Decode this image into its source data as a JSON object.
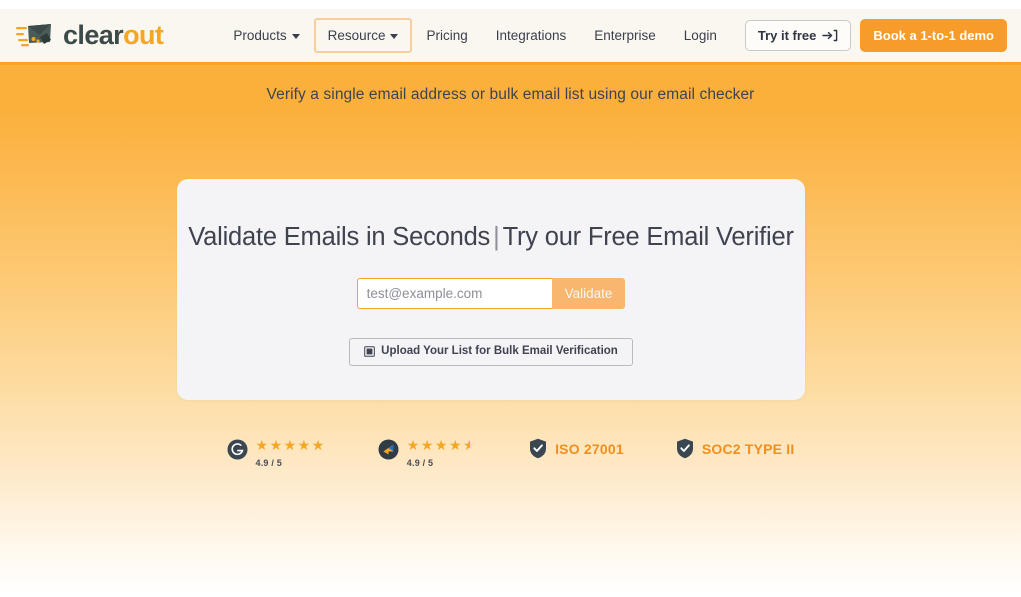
{
  "header": {
    "logo": {
      "icon": "envelope-megaphone-icon",
      "text_primary": "clear",
      "text_accent": "out",
      "accent_color": "#f6a623",
      "primary_color": "#3c4b4a"
    },
    "nav": [
      {
        "label": "Products",
        "has_dropdown": true,
        "focused": false
      },
      {
        "label": "Resource",
        "has_dropdown": true,
        "focused": true
      },
      {
        "label": "Pricing",
        "has_dropdown": false,
        "focused": false
      },
      {
        "label": "Integrations",
        "has_dropdown": false,
        "focused": false
      },
      {
        "label": "Enterprise",
        "has_dropdown": false,
        "focused": false
      },
      {
        "label": "Login",
        "has_dropdown": false,
        "focused": false
      }
    ],
    "try_button": {
      "label": "Try it free",
      "icon": "arrow-right-bracket-icon"
    },
    "demo_button": {
      "label": "Book a 1-to-1 demo",
      "color": "#f79c2a"
    }
  },
  "hero": {
    "subtitle": "Verify a single email address or bulk email list using our email checker",
    "background_top_color": "#fbb03b",
    "background_bottom_color": "#ffffff"
  },
  "card": {
    "title_part1": "Validate Emails in Seconds",
    "title_divider": "|",
    "title_part2": "Try our Free Email Verifier",
    "email_input": {
      "placeholder": "test@example.com",
      "value": "",
      "border_color": "#f5a623"
    },
    "validate_button": {
      "label": "Validate",
      "color": "#f8b66e"
    },
    "upload_button": {
      "label": "Upload Your List for Bulk Email Verification",
      "icon": "upload-document-icon"
    }
  },
  "badges": {
    "ratings": [
      {
        "platform_icon": "g2-logo-icon",
        "stars": 5,
        "half_star": false,
        "score": "4.9 / 5"
      },
      {
        "platform_icon": "capterra-logo-icon",
        "stars": 4,
        "half_star": true,
        "score": "4.9 / 5"
      }
    ],
    "certifications": [
      {
        "icon": "shield-check-icon",
        "label": "ISO 27001"
      },
      {
        "icon": "shield-check-icon",
        "label": "SOC2 TYPE II"
      }
    ],
    "star_color": "#f5a623",
    "cert_label_color": "#f18f1e"
  }
}
